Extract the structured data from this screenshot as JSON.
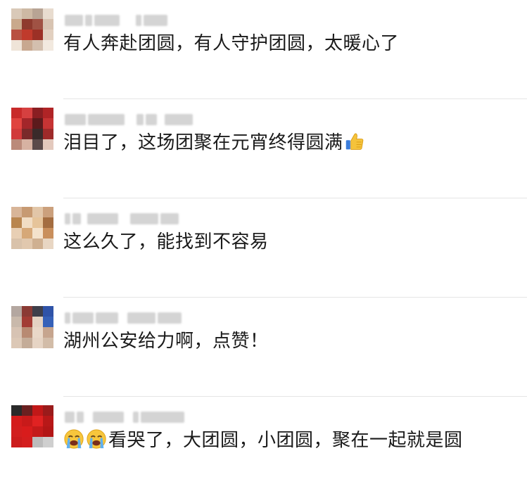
{
  "comments": [
    {
      "text": "有人奔赴团圆，有人守护团圆，太暖心了",
      "avatar_colors": [
        "#d9c9b8",
        "#cdb9a4",
        "#b8a494",
        "#e8dccf",
        "#c9a98c",
        "#8e3a2e",
        "#a05244",
        "#d8c4b2",
        "#b85042",
        "#c03a2c",
        "#9c3026",
        "#e2d0c0",
        "#efe4d8",
        "#c8a890",
        "#d3bfae",
        "#f2e9df"
      ]
    },
    {
      "text": "泪目了，这场团聚在元宵终得圆满",
      "emoji_after": "thumbs-up-icon",
      "avatar_colors": [
        "#c82a2a",
        "#d64040",
        "#8a1e22",
        "#b02426",
        "#e0433f",
        "#a3262a",
        "#5c1a1c",
        "#c63434",
        "#d13a3a",
        "#7a2a2a",
        "#3a2a2a",
        "#9e2a2a",
        "#bb8a7a",
        "#d7b2a2",
        "#5b4a4a",
        "#e3c9bd"
      ]
    },
    {
      "text": "这么久了，能找到不容易",
      "avatar_colors": [
        "#d8b598",
        "#c79a72",
        "#e2c6a8",
        "#cba07c",
        "#b9864f",
        "#f1ddc4",
        "#e6c49a",
        "#a46d40",
        "#e8cfb4",
        "#d6a878",
        "#f4e2cc",
        "#c98f5c",
        "#d9c2aa",
        "#e1c8ae",
        "#cfb091",
        "#e8d6c3"
      ]
    },
    {
      "text": "湖州公安给力啊，点赞！",
      "avatar_colors": [
        "#b4a7a0",
        "#8a3a34",
        "#3f3f4a",
        "#2f53a8",
        "#c9b9ab",
        "#a23c34",
        "#e4d2c2",
        "#3661b8",
        "#d7c3b3",
        "#b88a72",
        "#e9d8c8",
        "#c6a58e",
        "#dcc8b6",
        "#c4ac98",
        "#e6d4c4",
        "#d2bca8"
      ]
    },
    {
      "text": "看哭了，大团圆，小团圆，聚在一起就是圆",
      "emoji_before": [
        "loudly-crying-face-icon",
        "loudly-crying-face-icon"
      ],
      "avatar_colors": [
        "#2a2a2a",
        "#6a2020",
        "#c21818",
        "#9a1b1b",
        "#d41c1c",
        "#c81a1a",
        "#e02222",
        "#b81818",
        "#d21e1e",
        "#d81c1c",
        "#c41a1a",
        "#b31616",
        "#cc1c1c",
        "#d41e1e",
        "#bcbcbc",
        "#cfcfcf"
      ]
    }
  ]
}
